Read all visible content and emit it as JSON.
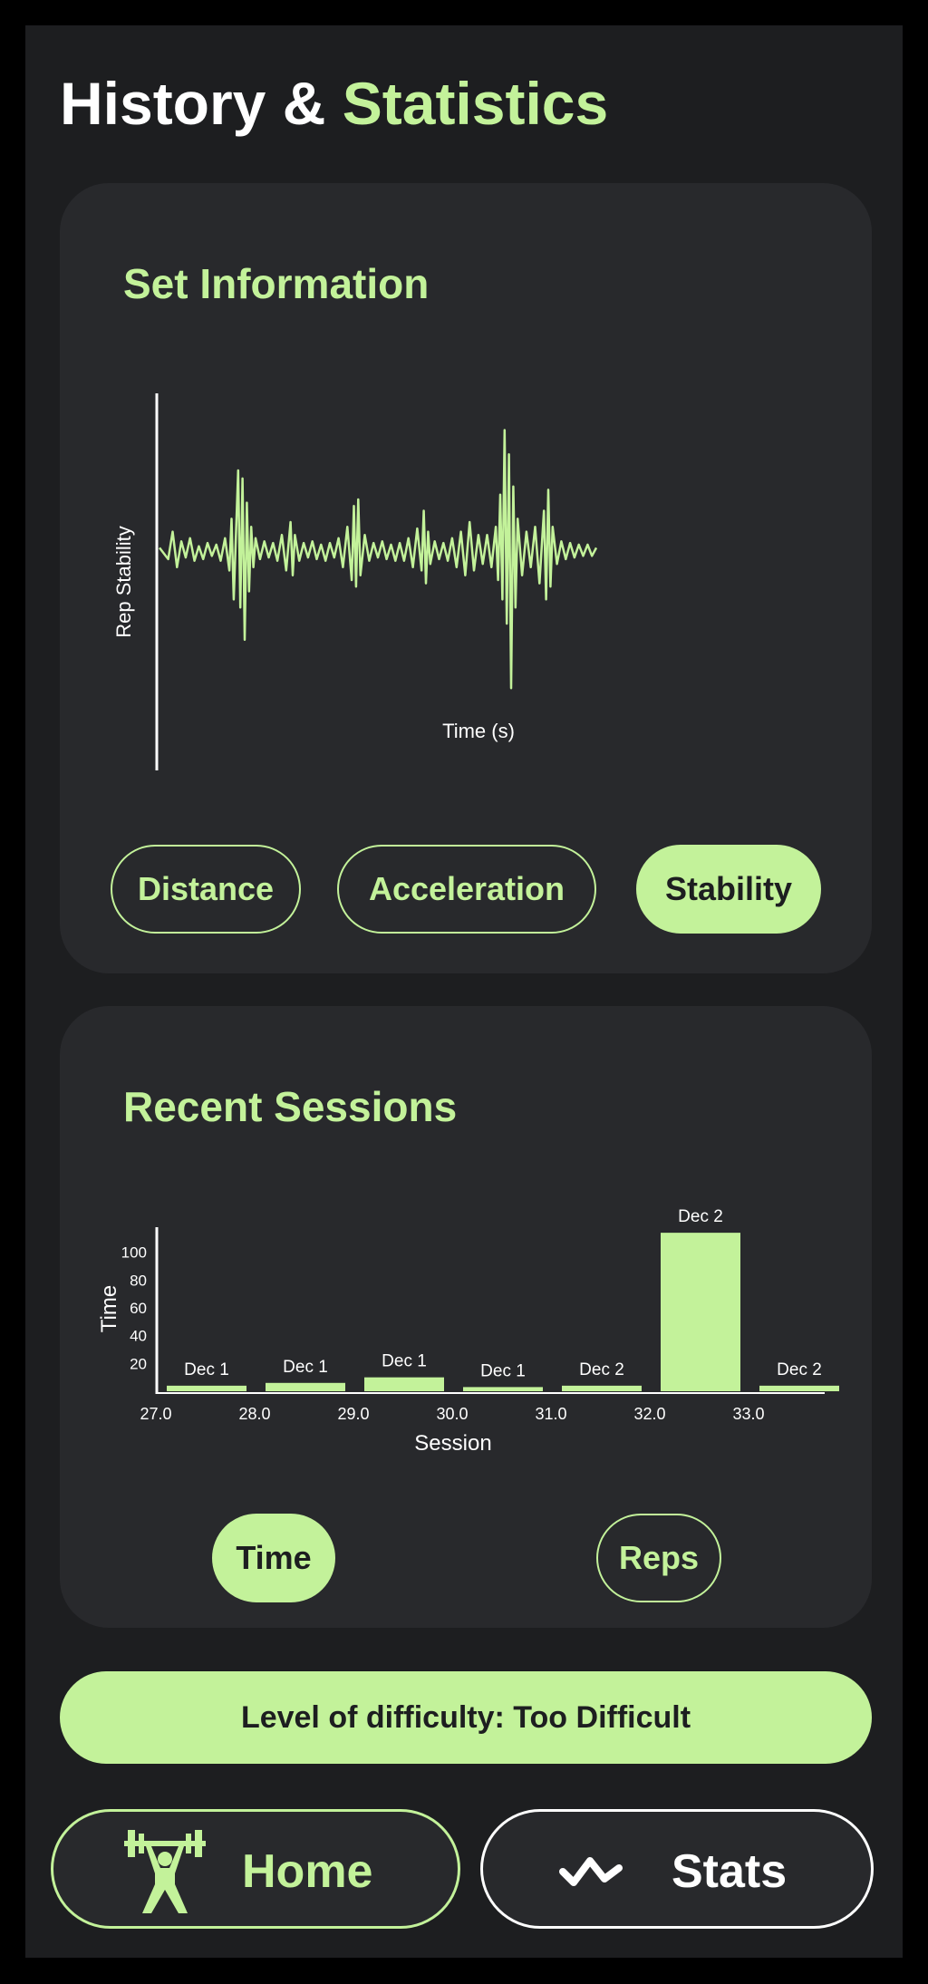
{
  "header": {
    "title_main": "History & ",
    "title_accent": "Statistics"
  },
  "colors": {
    "accent": "#c3f29a",
    "background": "#1d1e20",
    "card": "#28292c",
    "text": "#ffffff"
  },
  "set_information": {
    "title": "Set Information",
    "buttons": [
      {
        "label": "Distance",
        "active": false
      },
      {
        "label": "Acceleration",
        "active": false
      },
      {
        "label": "Stability",
        "active": true
      }
    ],
    "chart_data": {
      "type": "line",
      "xlabel": "Time (s)",
      "ylabel": "Rep Stability",
      "ylim": [
        -1,
        1
      ],
      "xlim": [
        0,
        100
      ],
      "grid": false,
      "legend": "none",
      "series": [
        {
          "values": [
            [
              0,
              0.02
            ],
            [
              2,
              -0.05
            ],
            [
              3,
              0.12
            ],
            [
              4,
              -0.1
            ],
            [
              5,
              0.06
            ],
            [
              6,
              -0.04
            ],
            [
              7,
              0.08
            ],
            [
              8,
              -0.06
            ],
            [
              9,
              0.03
            ],
            [
              10,
              -0.05
            ],
            [
              11,
              0.05
            ],
            [
              12,
              -0.03
            ],
            [
              13,
              0.04
            ],
            [
              14,
              -0.06
            ],
            [
              15,
              0.08
            ],
            [
              16,
              -0.12
            ],
            [
              16.5,
              0.2
            ],
            [
              17,
              -0.3
            ],
            [
              18,
              0.5
            ],
            [
              18.5,
              -0.35
            ],
            [
              19,
              0.45
            ],
            [
              19.5,
              -0.55
            ],
            [
              20,
              0.3
            ],
            [
              20.5,
              -0.25
            ],
            [
              21,
              0.15
            ],
            [
              21.5,
              -0.1
            ],
            [
              22,
              0.08
            ],
            [
              23,
              -0.05
            ],
            [
              24,
              0.06
            ],
            [
              25,
              -0.04
            ],
            [
              26,
              0.05
            ],
            [
              27,
              -0.06
            ],
            [
              28,
              0.1
            ],
            [
              29,
              -0.12
            ],
            [
              30,
              0.18
            ],
            [
              30.5,
              -0.15
            ],
            [
              31,
              0.1
            ],
            [
              32,
              -0.06
            ],
            [
              33,
              0.05
            ],
            [
              34,
              -0.04
            ],
            [
              35,
              0.06
            ],
            [
              36,
              -0.05
            ],
            [
              37,
              0.04
            ],
            [
              38,
              -0.06
            ],
            [
              39,
              0.05
            ],
            [
              40,
              -0.04
            ],
            [
              41,
              0.08
            ],
            [
              42,
              -0.1
            ],
            [
              43,
              0.15
            ],
            [
              44,
              -0.18
            ],
            [
              44.5,
              0.28
            ],
            [
              45,
              -0.22
            ],
            [
              45.5,
              0.32
            ],
            [
              46,
              -0.15
            ],
            [
              47,
              0.1
            ],
            [
              48,
              -0.06
            ],
            [
              49,
              0.05
            ],
            [
              50,
              -0.04
            ],
            [
              51,
              0.06
            ],
            [
              52,
              -0.05
            ],
            [
              53,
              0.04
            ],
            [
              54,
              -0.06
            ],
            [
              55,
              0.05
            ],
            [
              56,
              -0.06
            ],
            [
              57,
              0.08
            ],
            [
              58,
              -0.1
            ],
            [
              59,
              0.14
            ],
            [
              60,
              -0.12
            ],
            [
              60.5,
              0.25
            ],
            [
              61,
              -0.2
            ],
            [
              61.5,
              0.12
            ],
            [
              62,
              -0.08
            ],
            [
              63,
              0.06
            ],
            [
              64,
              -0.05
            ],
            [
              65,
              0.05
            ],
            [
              66,
              -0.06
            ],
            [
              67,
              0.08
            ],
            [
              68,
              -0.1
            ],
            [
              69,
              0.12
            ],
            [
              70,
              -0.15
            ],
            [
              71,
              0.18
            ],
            [
              72,
              -0.12
            ],
            [
              73,
              0.1
            ],
            [
              74,
              -0.08
            ],
            [
              75,
              0.1
            ],
            [
              76,
              -0.1
            ],
            [
              77,
              0.15
            ],
            [
              77.5,
              -0.18
            ],
            [
              78,
              0.35
            ],
            [
              78.5,
              -0.3
            ],
            [
              79,
              0.75
            ],
            [
              79.5,
              -0.45
            ],
            [
              80,
              0.6
            ],
            [
              80.5,
              -0.85
            ],
            [
              81,
              0.4
            ],
            [
              81.5,
              -0.35
            ],
            [
              82,
              0.2
            ],
            [
              83,
              -0.15
            ],
            [
              84,
              0.12
            ],
            [
              85,
              -0.1
            ],
            [
              86,
              0.15
            ],
            [
              87,
              -0.2
            ],
            [
              88,
              0.25
            ],
            [
              88.5,
              -0.3
            ],
            [
              89,
              0.38
            ],
            [
              89.5,
              -0.22
            ],
            [
              90,
              0.15
            ],
            [
              91,
              -0.08
            ],
            [
              92,
              0.06
            ],
            [
              93,
              -0.05
            ],
            [
              94,
              0.05
            ],
            [
              95,
              -0.04
            ],
            [
              96,
              0.04
            ],
            [
              97,
              -0.03
            ],
            [
              98,
              0.04
            ],
            [
              99,
              -0.03
            ],
            [
              100,
              0.02
            ]
          ]
        }
      ]
    }
  },
  "recent_sessions": {
    "title": "Recent Sessions",
    "buttons": [
      {
        "label": "Time",
        "active": true
      },
      {
        "label": "Reps",
        "active": false
      }
    ],
    "chart_data": {
      "type": "bar",
      "xlabel": "Session",
      "ylabel": "Time",
      "x": [
        27.0,
        28.0,
        29.0,
        30.0,
        31.0,
        32.0,
        33.0
      ],
      "x_tick_labels": [
        "27.0",
        "28.0",
        "29.0",
        "30.0",
        "31.0",
        "32.0",
        "33.0"
      ],
      "y_ticks": [
        "20",
        "40",
        "60",
        "80",
        "100"
      ],
      "values": [
        4,
        6,
        10,
        3,
        4,
        114,
        4
      ],
      "data_labels": [
        "Dec 1",
        "Dec 1",
        "Dec 1",
        "Dec 1",
        "Dec 2",
        "Dec 2",
        "Dec 2"
      ],
      "ylim": [
        0,
        118
      ],
      "grid": false
    }
  },
  "difficulty": {
    "label": "Level of difficulty: Too Difficult"
  },
  "nav": {
    "home": {
      "label": "Home",
      "icon": "weightlifter-icon"
    },
    "stats": {
      "label": "Stats",
      "icon": "wave-icon"
    }
  }
}
